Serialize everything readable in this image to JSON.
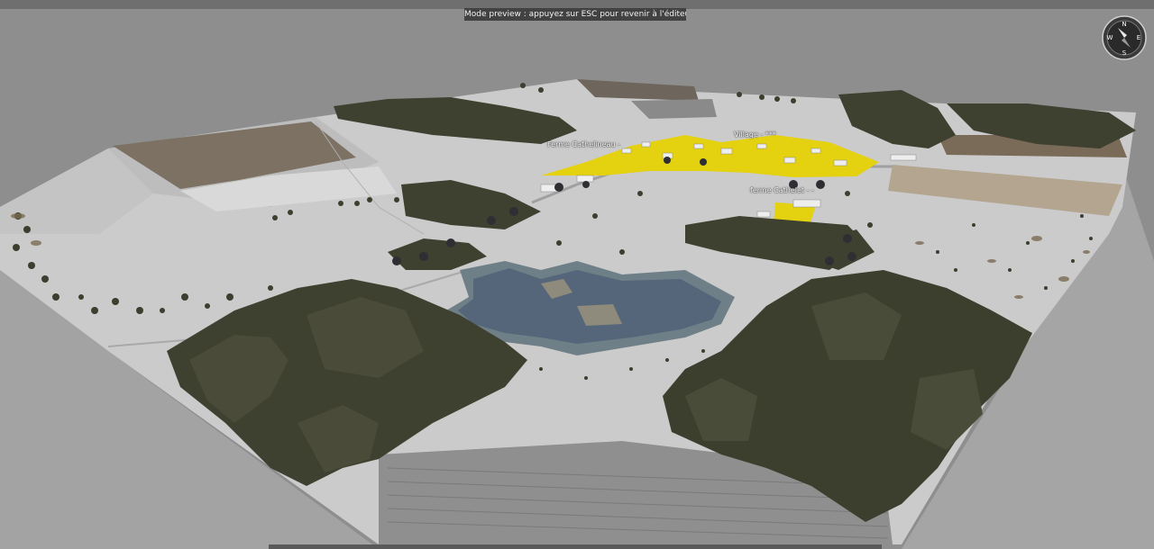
{
  "preview": {
    "banner_text": "Mode preview : appuyez sur ESC pour revenir à l'éditeur"
  },
  "map_labels": {
    "ferme_cathelineau": "Ferme Cathelineau -",
    "village": "Village - ***",
    "ferme_cathelet": "ferme Cathelet - -"
  },
  "compass": {
    "north": "N",
    "south": "S",
    "east": "E",
    "west": "W"
  },
  "colors": {
    "sky": "#8e8e8e",
    "ground": "#c9c9c9",
    "tree": "#3d3f2e",
    "water": "#5f6f7c",
    "highlight": "#e6d21c",
    "field": "#7b7060"
  }
}
